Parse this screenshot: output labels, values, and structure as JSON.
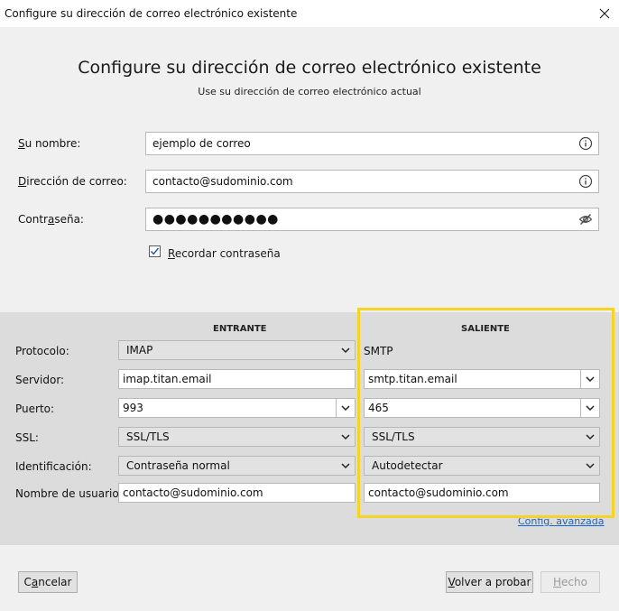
{
  "window": {
    "title": "Configure su dirección de correo electrónico existente"
  },
  "header": {
    "title": "Configure su dirección de correo electrónico existente",
    "subtitle": "Use su dirección de correo electrónico actual"
  },
  "account": {
    "name_label_accesskey": "S",
    "name_label_rest": "u nombre:",
    "name_value": "ejemplo de correo",
    "email_label_accesskey": "D",
    "email_label_rest": "irección de correo:",
    "email_value": "contacto@sudominio.com",
    "password_label_pre": "Contr",
    "password_label_accesskey": "a",
    "password_label_post": "seña:",
    "password_value": "●●●●●●●●●●●",
    "remember_accesskey": "R",
    "remember_rest": "ecordar contraseña",
    "remember_checked": true
  },
  "server": {
    "incoming_header": "ENTRANTE",
    "outgoing_header": "SALIENTE",
    "labels": {
      "protocol": "Protocolo:",
      "server": "Servidor:",
      "port": "Puerto:",
      "ssl": "SSL:",
      "auth": "Identificación:",
      "username": "Nombre de usuario:"
    },
    "incoming": {
      "protocol": "IMAP",
      "server": "imap.titan.email",
      "port": "993",
      "ssl": "SSL/TLS",
      "auth": "Contraseña normal",
      "username": "contacto@sudominio.com"
    },
    "outgoing": {
      "protocol": "SMTP",
      "server": "smtp.titan.email",
      "port": "465",
      "ssl": "SSL/TLS",
      "auth": "Autodetectar",
      "username": "contacto@sudominio.com"
    },
    "advanced_link": "Config. avanzada"
  },
  "buttons": {
    "cancel_accesskey": "a",
    "cancel_pre": "C",
    "cancel_post": "ncelar",
    "retest_accesskey": "V",
    "retest_rest": "olver a probar",
    "done_accesskey": "H",
    "done_rest": "echo"
  },
  "colors": {
    "highlight": "#f6d426",
    "link": "#1a64c8"
  },
  "icons": {
    "close": "close-icon",
    "info": "info-icon",
    "eye": "eye-slash-icon",
    "check": "checkmark-icon",
    "chevron": "chevron-down-icon"
  }
}
